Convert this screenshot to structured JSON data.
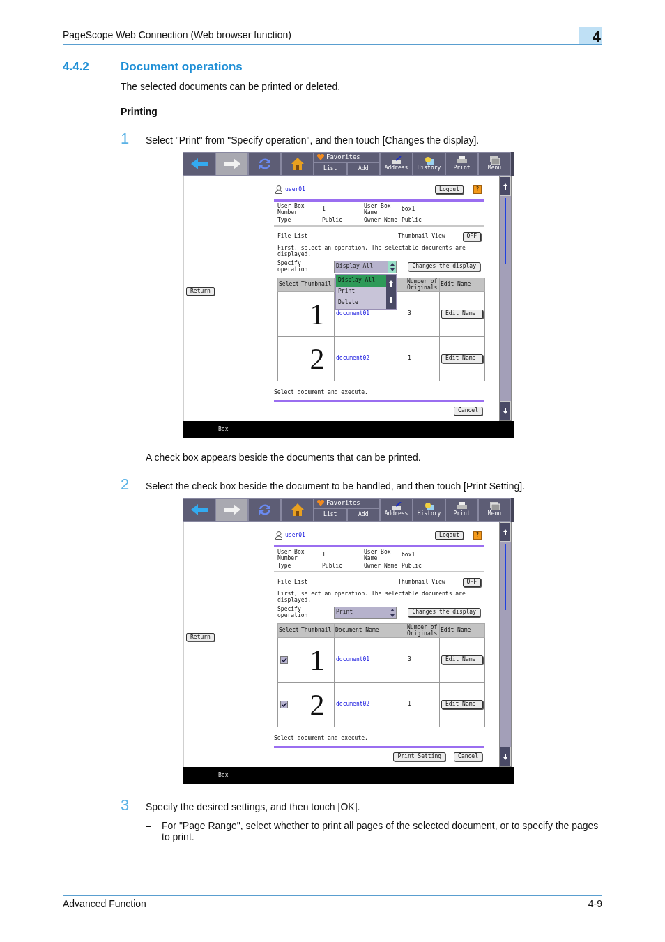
{
  "header": {
    "title": "PageScope Web Connection (Web browser function)",
    "chapter": "4"
  },
  "section": {
    "number": "4.4.2",
    "title": "Document operations"
  },
  "intro": "The selected documents can be printed or deleted.",
  "subheading": "Printing",
  "steps": [
    {
      "number": "1",
      "text": "Select \"Print\" from \"Specify operation\", and then touch [Changes the display].",
      "screen": {
        "toolbar": [
          {
            "kind": "back",
            "disabled": false
          },
          {
            "kind": "forward",
            "disabled": true
          },
          {
            "kind": "refresh",
            "disabled": false
          },
          {
            "kind": "home",
            "disabled": false
          },
          {
            "kind": "favorites",
            "label": "Favorites",
            "actions": [
              "List",
              "Add"
            ],
            "disabled": false
          },
          {
            "kind": "address",
            "label": "Address",
            "disabled": false
          },
          {
            "kind": "history",
            "label": "History",
            "disabled": false
          },
          {
            "kind": "print",
            "label": "Print",
            "disabled": false
          },
          {
            "kind": "menu",
            "label": "Menu",
            "disabled": false
          }
        ],
        "user": "user01",
        "logout": "Logout",
        "help": "?",
        "return": "Return",
        "info": [
          {
            "label": "User Box Number",
            "value": "1"
          },
          {
            "label": "User Box Name",
            "value": "box1"
          },
          {
            "label": "Type",
            "value": "Public"
          },
          {
            "label": "Owner Name",
            "value": "Public"
          }
        ],
        "file_list": "File List",
        "thumbnail_label": "Thumbnail View",
        "thumbnail_toggle": "OFF",
        "instruction": "First, select an operation. The selectable documents are displayed.",
        "specify_label": "Specify operation",
        "operation": "Display All",
        "dropdown": {
          "options": [
            {
              "label": "Display All",
              "selected": true
            },
            {
              "label": "Print",
              "selected": false
            },
            {
              "label": "Delete",
              "selected": false
            }
          ]
        },
        "change_button": "Changes the display",
        "columns": [
          {
            "label": "Select",
            "covered": false
          },
          {
            "label": "Thumbnail",
            "covered": false
          },
          {
            "covered": true
          },
          {
            "label": "Number of Originals",
            "covered": false
          },
          {
            "label": "Edit Name",
            "covered": false
          }
        ],
        "rows": [
          {
            "thumbnail": "1",
            "name": "document01",
            "originals": "3",
            "edit": "Edit Name"
          },
          {
            "thumbnail": "2",
            "name": "document02",
            "originals": "1",
            "edit": "Edit Name"
          }
        ],
        "status": "Select document and execute.",
        "buttons": [
          "Cancel"
        ],
        "status_bar": "Box"
      },
      "note": "A check box appears beside the documents that can be printed."
    },
    {
      "number": "2",
      "text": "Select the check box beside the document to be handled, and then touch [Print Setting].",
      "screen": {
        "toolbar": [
          {
            "kind": "back",
            "disabled": false
          },
          {
            "kind": "forward",
            "disabled": true
          },
          {
            "kind": "refresh",
            "disabled": false
          },
          {
            "kind": "home",
            "disabled": false
          },
          {
            "kind": "favorites",
            "label": "Favorites",
            "actions": [
              "List",
              "Add"
            ],
            "disabled": false
          },
          {
            "kind": "address",
            "label": "Address",
            "disabled": false
          },
          {
            "kind": "history",
            "label": "History",
            "disabled": false
          },
          {
            "kind": "print",
            "label": "Print",
            "disabled": false
          },
          {
            "kind": "menu",
            "label": "Menu",
            "disabled": false
          }
        ],
        "user": "user01",
        "logout": "Logout",
        "help": "?",
        "return": "Return",
        "info": [
          {
            "label": "User Box Number",
            "value": "1"
          },
          {
            "label": "User Box Name",
            "value": "box1"
          },
          {
            "label": "Type",
            "value": "Public"
          },
          {
            "label": "Owner Name",
            "value": "Public"
          }
        ],
        "file_list": "File List",
        "thumbnail_label": "Thumbnail View",
        "thumbnail_toggle": "OFF",
        "instruction": "First, select an operation. The selectable documents are displayed.",
        "specify_label": "Specify operation",
        "operation": "Print",
        "change_button": "Changes the display",
        "columns": [
          {
            "label": "Select",
            "covered": false
          },
          {
            "label": "Thumbnail",
            "covered": false
          },
          {
            "label": "Document Name",
            "covered": false
          },
          {
            "label": "Number of Originals",
            "covered": false
          },
          {
            "label": "Edit Name",
            "covered": false
          }
        ],
        "rows": [
          {
            "checked": true,
            "thumbnail": "1",
            "name": "document01",
            "originals": "3",
            "edit": "Edit Name"
          },
          {
            "checked": true,
            "thumbnail": "2",
            "name": "document02",
            "originals": "1",
            "edit": "Edit Name"
          }
        ],
        "status": "Select document and execute.",
        "buttons": [
          "Print Setting",
          "Cancel"
        ],
        "status_bar": "Box"
      }
    },
    {
      "number": "3",
      "text": "Specify the desired settings, and then touch [OK].",
      "bullets": [
        {
          "dash": "–",
          "text": "For \"Page Range\", select whether to print all pages of the selected document, or to specify the pages to print."
        }
      ]
    }
  ],
  "footer": {
    "left": "Advanced Function",
    "right": "4-9"
  }
}
